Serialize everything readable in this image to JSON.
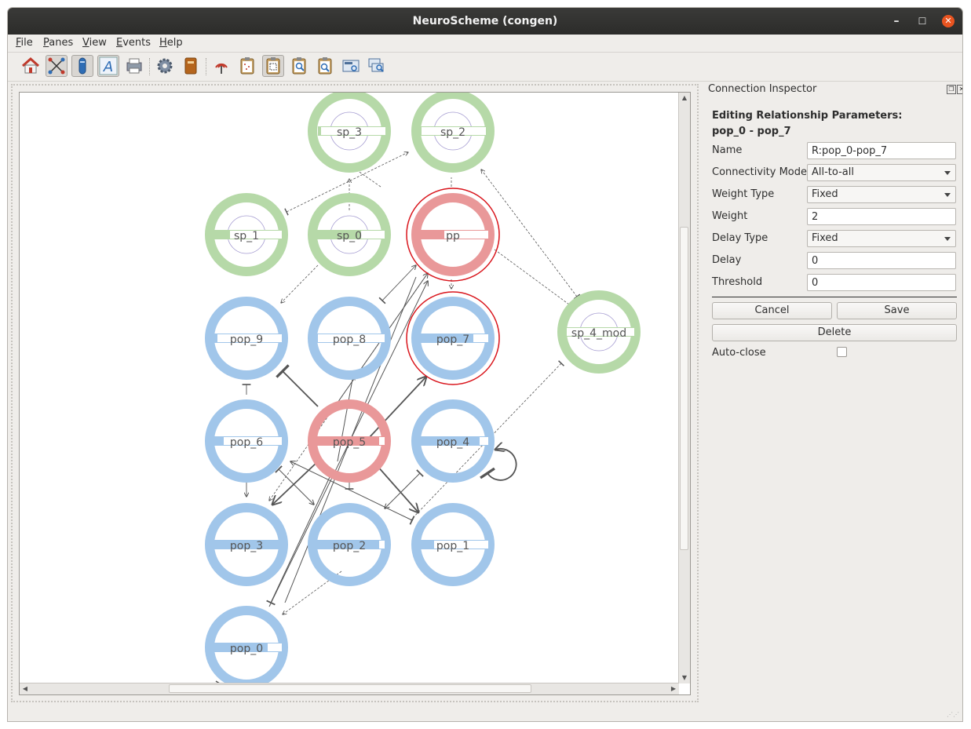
{
  "window": {
    "title": "NeuroScheme (congen)"
  },
  "window_controls": {
    "minimize": "–",
    "maximize": "☐",
    "close": "✕"
  },
  "menu": {
    "file": {
      "u": "F",
      "rest": "ile"
    },
    "panes": {
      "u": "P",
      "rest": "anes"
    },
    "view": {
      "u": "V",
      "rest": "iew"
    },
    "events": {
      "u": "E",
      "rest": "vents"
    },
    "help": {
      "u": "H",
      "rest": "elp"
    }
  },
  "toolbar": {
    "buttons": [
      "home",
      "connection-mode",
      "select-mode",
      "text-mode",
      "printer",
      "settings",
      "book",
      "signal",
      "clipboard-1",
      "clipboard-2",
      "clipboard-search-1",
      "clipboard-search-2",
      "screen-capture",
      "screen-search"
    ],
    "active": [
      "connection-mode",
      "select-mode",
      "text-mode",
      "clipboard-2"
    ]
  },
  "scene": {
    "nodes": {
      "sp_3": "sp_3",
      "sp_2": "sp_2",
      "sp_1": "sp_1",
      "sp_0": "sp_0",
      "pp": "pp",
      "pop_9": "pop_9",
      "pop_8": "pop_8",
      "pop_7": "pop_7",
      "sp_4_mod": "sp_4_mod",
      "pop_6": "pop_6",
      "pop_5": "pop_5",
      "pop_4": "pop_4",
      "pop_3": "pop_3",
      "pop_2": "pop_2",
      "pop_1": "pop_1",
      "pop_0": "pop_0"
    },
    "colors": {
      "population": "#a1c6ea",
      "super_population": "#b6d9a8",
      "selected": "#e99899",
      "selected_ring": "#d9151c"
    },
    "selected": [
      "pp",
      "pop_7",
      "pop_5"
    ]
  },
  "inspector": {
    "title": "Connection Inspector",
    "heading": "Editing Relationship Parameters:",
    "relationship": "pop_0 - pop_7",
    "fields": {
      "name": {
        "label": "Name",
        "value": "R:pop_0-pop_7"
      },
      "connectivity_model": {
        "label": "Connectivity Model",
        "value": "All-to-all"
      },
      "weight_type": {
        "label": "Weight Type",
        "value": "Fixed"
      },
      "weight": {
        "label": "Weight",
        "value": "2"
      },
      "delay_type": {
        "label": "Delay Type",
        "value": "Fixed"
      },
      "delay": {
        "label": "Delay",
        "value": "0"
      },
      "threshold": {
        "label": "Threshold",
        "value": "0"
      }
    },
    "buttons": {
      "cancel": "Cancel",
      "save": "Save",
      "delete": "Delete"
    },
    "auto_close": {
      "label": "Auto-close",
      "checked": false
    }
  }
}
